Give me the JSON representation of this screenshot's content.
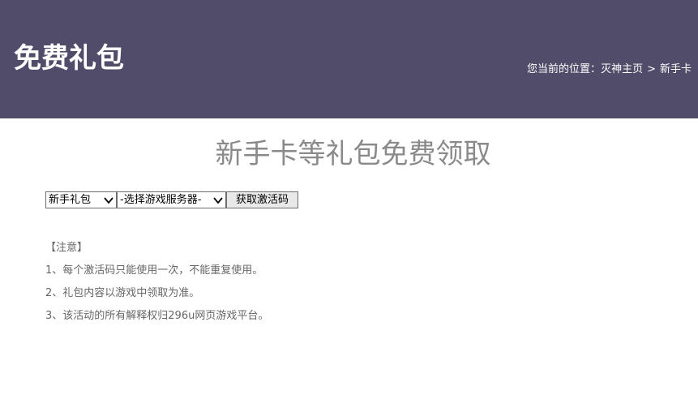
{
  "header": {
    "title": "免费礼包",
    "breadcrumb": {
      "prefix": "您当前的位置：",
      "home": "灭神主页",
      "separator": ">",
      "current": "新手卡"
    }
  },
  "main": {
    "heading": "新手卡等礼包免费领取",
    "form": {
      "gift_select": "新手礼包",
      "server_select": "-选择游戏服务器-",
      "submit_label": "获取激活码"
    },
    "notes": {
      "title": "【注意】",
      "items": [
        "1、每个激活码只能使用一次，不能重复使用。",
        "2、礼包内容以游戏中领取为准。",
        "3、该活动的所有解释权归296u网页游戏平台。"
      ]
    }
  },
  "colors": {
    "header_bg": "#504c6a",
    "heading_text": "#8a8a8a",
    "notes_text": "#666666"
  }
}
